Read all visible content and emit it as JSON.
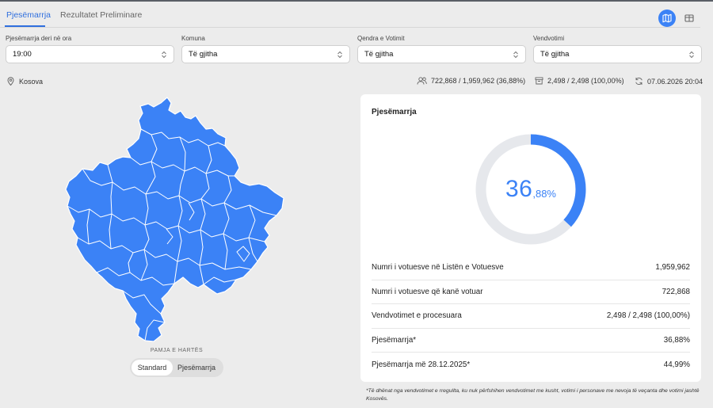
{
  "tabs": [
    {
      "label": "Pjesëmarrja",
      "active": true
    },
    {
      "label": "Rezultatet Preliminare",
      "active": false
    }
  ],
  "view_buttons": [
    {
      "icon": "map-icon",
      "active": true
    },
    {
      "icon": "table-icon",
      "active": false
    }
  ],
  "filters": [
    {
      "label": "Pjesëmarrja deri në ora",
      "value": "19:00"
    },
    {
      "label": "Komuna",
      "value": "Të gjitha"
    },
    {
      "label": "Qendra e Votimit",
      "value": "Të gjitha"
    },
    {
      "label": "Vendvotimi",
      "value": "Të gjitha"
    }
  ],
  "location": {
    "icon": "location-pin-icon",
    "name": "Kosova"
  },
  "stats": {
    "voters": "722,868 / 1,959,962 (36,88%)",
    "stations": "2,498 / 2,498 (100,00%)",
    "updated": "07.06.2026 20:04"
  },
  "map": {
    "caption": "PAMJA E HARTËS",
    "fill_color": "#3b82f6",
    "toggle": [
      "Standard",
      "Pjesëmarrja"
    ]
  },
  "panel": {
    "title": "Pjesëmarrja",
    "gauge": {
      "percent": 36.88,
      "int_part": "36",
      "dec_part": ",88%",
      "color": "#3b82f6",
      "track_color": "#e6e8ec"
    },
    "rows": [
      {
        "label": "Numri i votuesve në Listën e Votuesve",
        "value": "1,959,962"
      },
      {
        "label": "Numri i votuesve që kanë votuar",
        "value": "722,868"
      },
      {
        "label": "Vendvotimet e procesuara",
        "value": "2,498 / 2,498 (100,00%)"
      },
      {
        "label": "Pjesëmarrja*",
        "value": "36,88%"
      },
      {
        "label": "Pjesëmarrja më 28.12.2025*",
        "value": "44,99%"
      }
    ]
  },
  "footnote": "*Të dhënat nga vendvotimet e rregullta, ku nuk përfshihen vendvotimet me kusht, votimi i personave me nevoja të veçanta dhe votimi jashtë Kosovës."
}
